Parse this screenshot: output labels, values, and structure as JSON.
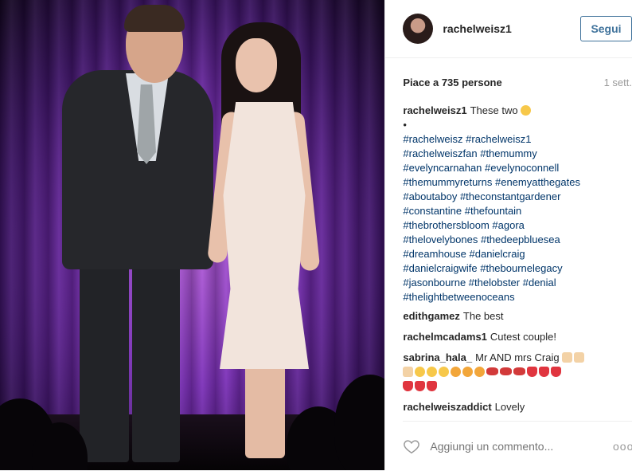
{
  "header": {
    "username": "rachelweisz1",
    "follow_label": "Segui"
  },
  "meta": {
    "likes": "Piace a 735 persone",
    "time": "1 sett."
  },
  "caption": {
    "user": "rachelweisz1",
    "text": "These two",
    "bullet": "•",
    "hashtags": [
      "#rachelweisz #rachelweisz1",
      "#rachelweiszfan #themummy",
      "#evelyncarnahan #evelynoconnell",
      "#themummyreturns #enemyatthegates",
      "#aboutaboy #theconstantgardener",
      "#constantine #thefountain",
      "#thebrothersbloom #agora",
      "#thelovelybones #thedeepbluesea",
      "#dreamhouse #danielcraig",
      "#danielcraigwife #thebournelegacy",
      "#jasonbourne #thelobster #denial",
      "#thelightbetweenoceans"
    ]
  },
  "comments": [
    {
      "user": "edithgamez",
      "text": "The best"
    },
    {
      "user": "rachelmcadams1",
      "text": "Cutest couple!"
    },
    {
      "user": "sabrina_hala_",
      "text": "Mr AND mrs Craig"
    },
    {
      "user": "rachelweiszaddict",
      "text": "Lovely"
    }
  ],
  "footer": {
    "comment_placeholder": "Aggiungi un commento...",
    "more_label": "ooo"
  },
  "icons": [
    "heart-eyes-emoji",
    "heart-icon",
    "more-options-icon"
  ]
}
